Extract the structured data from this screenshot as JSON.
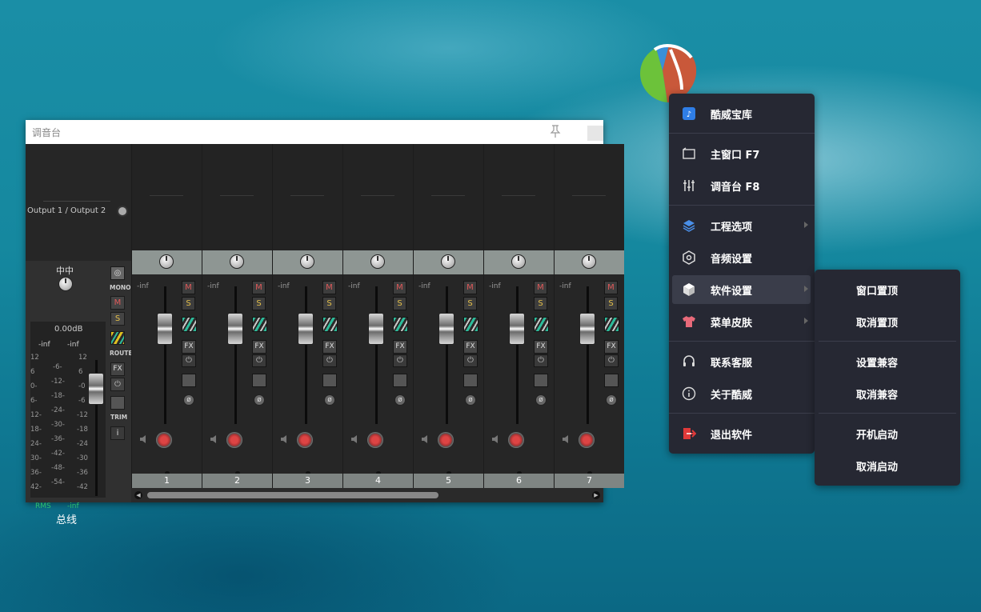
{
  "desktop": {
    "logo_icon": "reaper-logo"
  },
  "mixer": {
    "title": "调音台",
    "master": {
      "output": "Output 1 / Output 2",
      "pan_label": "中中",
      "db_value": "0.00dB",
      "peak_left": "-inf",
      "peak_right": "-inf",
      "scale_left": [
        "12",
        "6",
        "0-",
        "6-",
        "12-",
        "18-",
        "24-",
        "30-",
        "36-",
        "42-"
      ],
      "scale_mid": [
        "-6-",
        "-12-",
        "-18-",
        "-24-",
        "-30-",
        "-36-",
        "-42-",
        "-48-",
        "-54-"
      ],
      "scale_right": [
        "12",
        "6",
        "-0",
        "-6",
        "-12",
        "-18",
        "-24",
        "-30",
        "-36",
        "-42"
      ],
      "rms_label": "RMS",
      "rms_value": "-inf",
      "bus_label": "总线",
      "mono_label": "MONO",
      "route_label": "ROUTE",
      "trim_label": "TRIM",
      "mute_label": "M",
      "solo_label": "S",
      "fx_label": "FX",
      "info_label": "i"
    },
    "strips": [
      {
        "number": "1",
        "level": "-inf",
        "mute": "M",
        "solo": "S",
        "fx": "FX"
      },
      {
        "number": "2",
        "level": "-inf",
        "mute": "M",
        "solo": "S",
        "fx": "FX"
      },
      {
        "number": "3",
        "level": "-inf",
        "mute": "M",
        "solo": "S",
        "fx": "FX"
      },
      {
        "number": "4",
        "level": "-inf",
        "mute": "M",
        "solo": "S",
        "fx": "FX"
      },
      {
        "number": "5",
        "level": "-inf",
        "mute": "M",
        "solo": "S",
        "fx": "FX"
      },
      {
        "number": "6",
        "level": "-inf",
        "mute": "M",
        "solo": "S",
        "fx": "FX"
      },
      {
        "number": "7",
        "level": "-inf",
        "mute": "M",
        "solo": "S",
        "fx": "FX"
      }
    ]
  },
  "menu": {
    "items": [
      {
        "label": "酷威宝库",
        "icon": "music-library-icon"
      },
      {
        "label": "主窗口  F7",
        "icon": "window-icon"
      },
      {
        "label": "调音台  F8",
        "icon": "mixer-sliders-icon"
      },
      {
        "label": "工程选项",
        "icon": "layers-icon",
        "submenu": true
      },
      {
        "label": "音频设置",
        "icon": "hex-settings-icon"
      },
      {
        "label": "软件设置",
        "icon": "cube-icon",
        "submenu": true,
        "highlighted": true
      },
      {
        "label": "菜单皮肤",
        "icon": "tshirt-icon",
        "submenu": true
      },
      {
        "label": "联系客服",
        "icon": "headset-icon"
      },
      {
        "label": "关于酷威",
        "icon": "info-icon"
      },
      {
        "label": "退出软件",
        "icon": "exit-icon"
      }
    ]
  },
  "submenu": {
    "items": [
      "窗口置顶",
      "取消置顶",
      "设置兼容",
      "取消兼容",
      "开机启动",
      "取消启动"
    ]
  },
  "colors": {
    "menu_bg": "#262833",
    "menu_highlight": "#3a3d4a",
    "mute": "#e05a5a",
    "solo": "#e5c04a",
    "rms_green": "#2dc26e"
  }
}
